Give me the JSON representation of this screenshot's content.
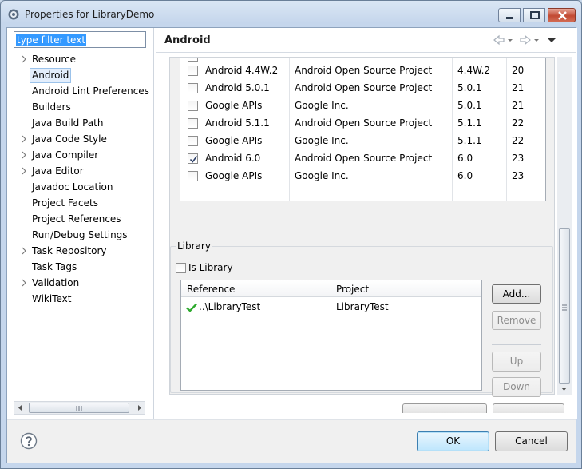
{
  "window": {
    "title": "Properties for LibraryDemo"
  },
  "filter": {
    "placeholder": "type filter text"
  },
  "tree": {
    "items": [
      {
        "label": "Resource",
        "expandable": true
      },
      {
        "label": "Android",
        "expandable": false,
        "selected": true
      },
      {
        "label": "Android Lint Preferences",
        "expandable": false
      },
      {
        "label": "Builders",
        "expandable": false
      },
      {
        "label": "Java Build Path",
        "expandable": false
      },
      {
        "label": "Java Code Style",
        "expandable": true
      },
      {
        "label": "Java Compiler",
        "expandable": true
      },
      {
        "label": "Java Editor",
        "expandable": true
      },
      {
        "label": "Javadoc Location",
        "expandable": false
      },
      {
        "label": "Project Facets",
        "expandable": false
      },
      {
        "label": "Project References",
        "expandable": false
      },
      {
        "label": "Run/Debug Settings",
        "expandable": false
      },
      {
        "label": "Task Repository",
        "expandable": true
      },
      {
        "label": "Task Tags",
        "expandable": false
      },
      {
        "label": "Validation",
        "expandable": true
      },
      {
        "label": "WikiText",
        "expandable": false
      }
    ]
  },
  "page": {
    "title": "Android"
  },
  "targets": {
    "rows": [
      {
        "name": "Android 4.4W.2",
        "vendor": "Android Open Source Project",
        "platform": "4.4W.2",
        "api": "20",
        "checked": false
      },
      {
        "name": "Android 5.0.1",
        "vendor": "Android Open Source Project",
        "platform": "5.0.1",
        "api": "21",
        "checked": false
      },
      {
        "name": "Google APIs",
        "vendor": "Google Inc.",
        "platform": "5.0.1",
        "api": "21",
        "checked": false
      },
      {
        "name": "Android 5.1.1",
        "vendor": "Android Open Source Project",
        "platform": "5.1.1",
        "api": "22",
        "checked": false
      },
      {
        "name": "Google APIs",
        "vendor": "Google Inc.",
        "platform": "5.1.1",
        "api": "22",
        "checked": false
      },
      {
        "name": "Android 6.0",
        "vendor": "Android Open Source Project",
        "platform": "6.0",
        "api": "23",
        "checked": true
      },
      {
        "name": "Google APIs",
        "vendor": "Google Inc.",
        "platform": "6.0",
        "api": "23",
        "checked": false
      }
    ]
  },
  "library": {
    "group_label": "Library",
    "is_library_label": "Is Library",
    "is_library_checked": false,
    "columns": {
      "reference": "Reference",
      "project": "Project"
    },
    "rows": [
      {
        "reference": "..\\LibraryTest",
        "project": "LibraryTest",
        "status": "ok"
      }
    ],
    "buttons": {
      "add": "Add...",
      "remove": "Remove",
      "up": "Up",
      "down": "Down"
    }
  },
  "footer": {
    "ok": "OK",
    "cancel": "Cancel"
  },
  "colors": {
    "accent": "#3399ff",
    "check_ok": "#2eaa2e",
    "close_button": "#c24a33"
  }
}
